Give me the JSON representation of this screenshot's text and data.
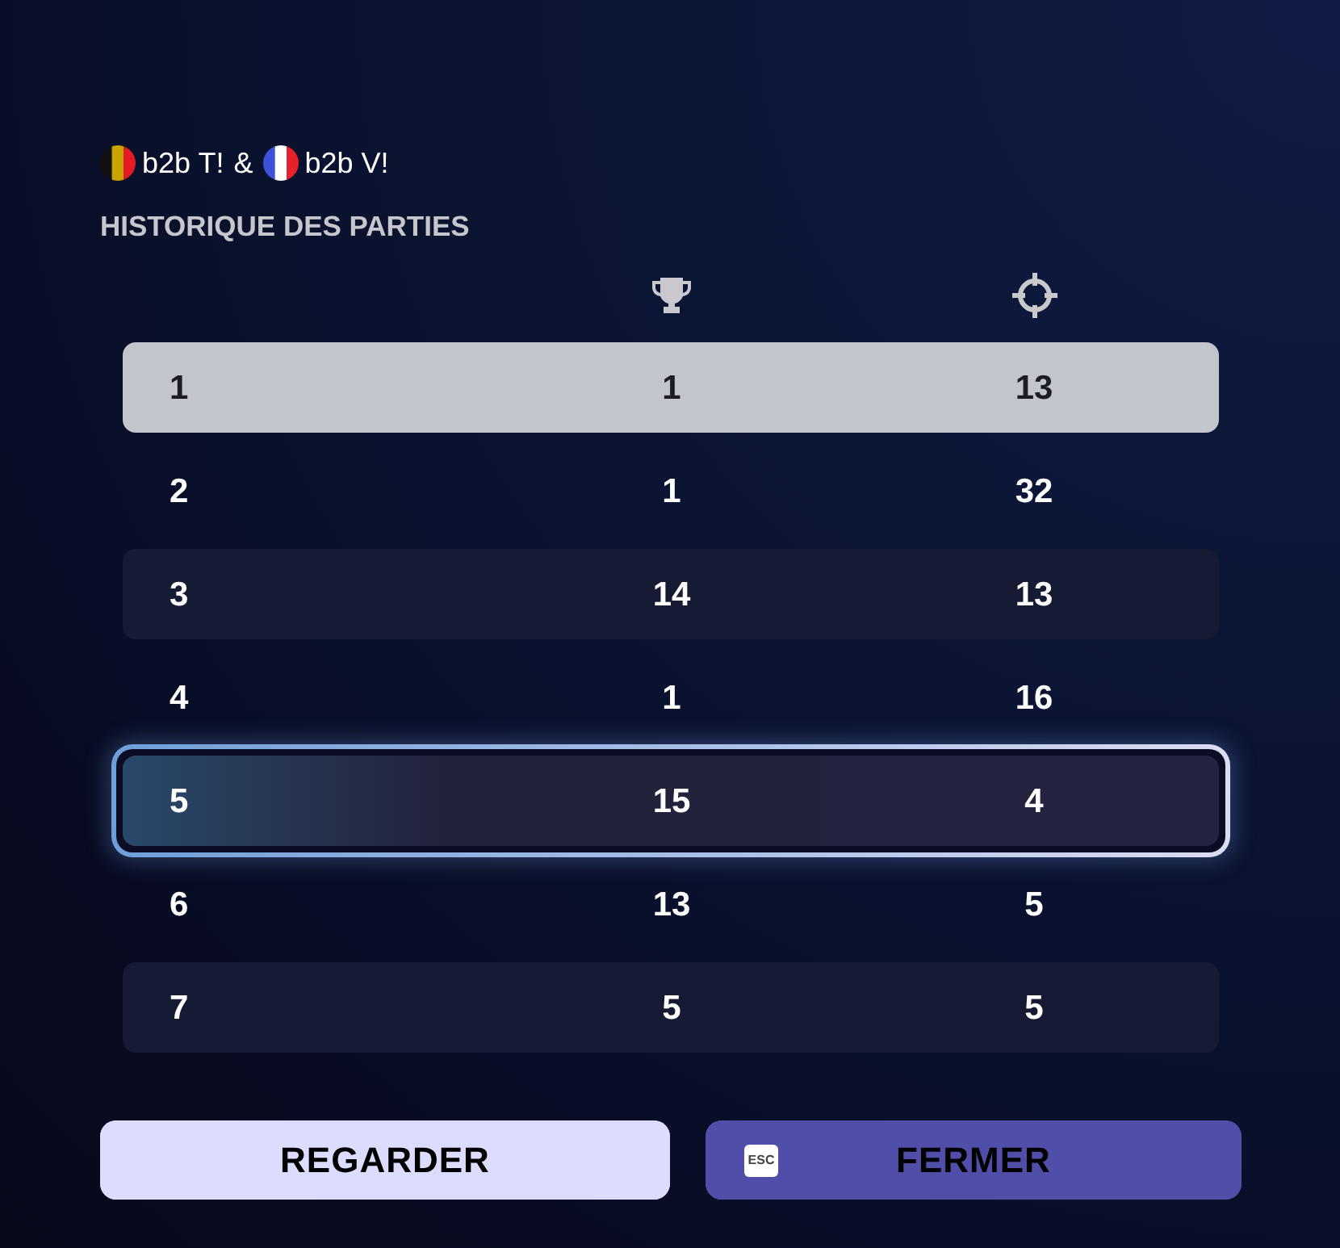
{
  "header": {
    "players": [
      {
        "kind": "belgium",
        "name": "b2b T!"
      },
      {
        "kind": "france",
        "name": "b2b V!"
      }
    ],
    "separator": "&",
    "title": "HISTORIQUE DES PARTIES"
  },
  "table": {
    "rows": [
      {
        "cells": [
          "1",
          "1",
          "13"
        ],
        "selected": true,
        "hovered": false
      },
      {
        "cells": [
          "2",
          "1",
          "32"
        ],
        "selected": false,
        "hovered": false
      },
      {
        "cells": [
          "3",
          "14",
          "13"
        ],
        "selected": false,
        "hovered": false
      },
      {
        "cells": [
          "4",
          "1",
          "16"
        ],
        "selected": false,
        "hovered": false
      },
      {
        "cells": [
          "5",
          "15",
          "4"
        ],
        "selected": false,
        "hovered": true
      },
      {
        "cells": [
          "6",
          "13",
          "5"
        ],
        "selected": false,
        "hovered": false
      },
      {
        "cells": [
          "7",
          "5",
          "5"
        ],
        "selected": false,
        "hovered": false
      }
    ]
  },
  "buttons": [
    {
      "kind": "secondary",
      "label": "REGARDER"
    },
    {
      "kind": "primary",
      "label": "FERMER",
      "key": "ESC"
    }
  ]
}
